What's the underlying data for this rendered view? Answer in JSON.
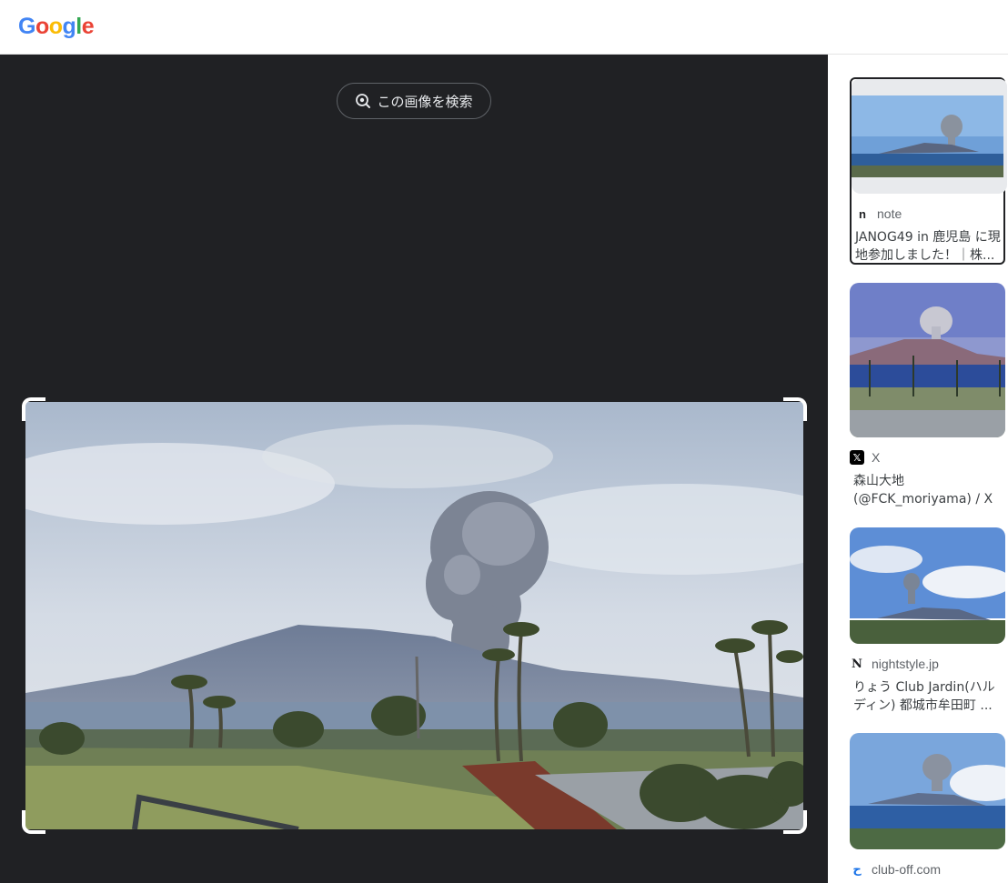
{
  "header": {
    "logo": [
      "G",
      "o",
      "o",
      "g",
      "l",
      "e"
    ],
    "logo_colors": [
      "#4285F4",
      "#EA4335",
      "#FBBC05",
      "#4285F4",
      "#34A853",
      "#EA4335"
    ]
  },
  "viewer": {
    "search_label": "この画像を検索",
    "background": "#202124"
  },
  "results": [
    {
      "source": "note",
      "title": "JANOG49 in 鹿児島 に現地参加しました！｜株...",
      "favicon": "n",
      "icon": "note-favicon-icon"
    },
    {
      "source": "X",
      "title": "森山大地 (@FCK_moriyama) / X",
      "favicon": "𝕏",
      "icon": "x-favicon-icon"
    },
    {
      "source": "nightstyle.jp",
      "title": "りょう Club Jardin(ハルディン) 都城市牟田町 ...",
      "favicon": "N",
      "icon": "nightstyle-favicon-icon"
    },
    {
      "source": "club-off.com",
      "title": "",
      "favicon": "ح",
      "icon": "club-off-favicon-icon"
    }
  ]
}
